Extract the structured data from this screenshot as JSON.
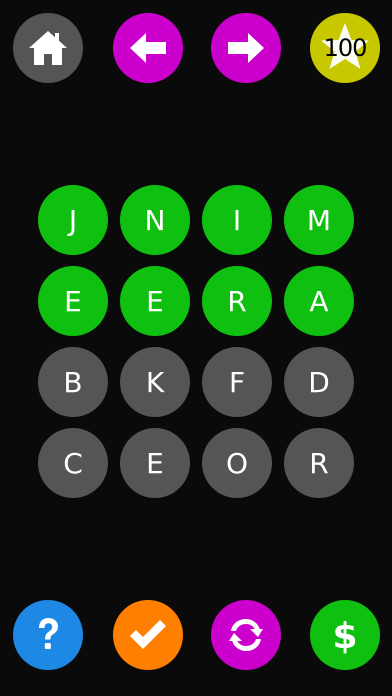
{
  "colors": {
    "background": "#0a0a0a",
    "home": "#555555",
    "arrow": "#cc00cc",
    "score": "#c8c800",
    "help": "#1e88e5",
    "check": "#ff7f00",
    "refresh": "#cc00cc",
    "store": "#10c010",
    "tile_selected": "#10c010",
    "tile_available": "#555555"
  },
  "top_bar": {
    "home_icon": "house-icon",
    "back_icon": "arrow-left-icon",
    "forward_icon": "arrow-right-icon",
    "score": "100"
  },
  "bottom_bar": {
    "help_icon": "question-mark-icon",
    "check_icon": "checkmark-icon",
    "refresh_icon": "refresh-icon",
    "store_icon": "dollar-icon"
  },
  "tiles": [
    {
      "letter": "J",
      "state": "selected"
    },
    {
      "letter": "N",
      "state": "selected"
    },
    {
      "letter": "I",
      "state": "selected"
    },
    {
      "letter": "M",
      "state": "selected"
    },
    {
      "letter": "E",
      "state": "selected"
    },
    {
      "letter": "E",
      "state": "selected"
    },
    {
      "letter": "R",
      "state": "selected"
    },
    {
      "letter": "A",
      "state": "selected"
    },
    {
      "letter": "B",
      "state": "available"
    },
    {
      "letter": "K",
      "state": "available"
    },
    {
      "letter": "F",
      "state": "available"
    },
    {
      "letter": "D",
      "state": "available"
    },
    {
      "letter": "C",
      "state": "available"
    },
    {
      "letter": "E",
      "state": "available"
    },
    {
      "letter": "O",
      "state": "available"
    },
    {
      "letter": "R",
      "state": "available"
    }
  ]
}
